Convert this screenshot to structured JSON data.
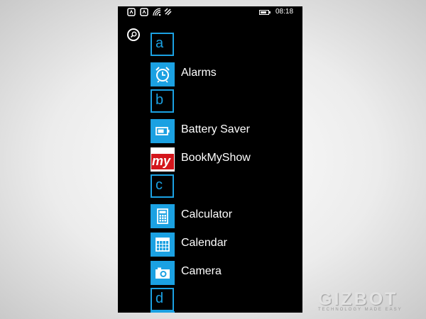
{
  "status_bar": {
    "time": "08:18",
    "icons": [
      "signal-icon",
      "signal-icon",
      "wifi-icon",
      "data-icon",
      "battery-icon"
    ]
  },
  "search": {
    "icon": "search-icon"
  },
  "sections": [
    {
      "letter": "a",
      "apps": [
        {
          "name": "Alarms",
          "icon": "alarm-clock-icon"
        }
      ]
    },
    {
      "letter": "b",
      "apps": [
        {
          "name": "Battery Saver",
          "icon": "battery-saver-icon"
        },
        {
          "name": "BookMyShow",
          "icon": "bookmyshow-logo"
        }
      ]
    },
    {
      "letter": "c",
      "apps": [
        {
          "name": "Calculator",
          "icon": "calculator-icon"
        },
        {
          "name": "Calendar",
          "icon": "calendar-icon"
        },
        {
          "name": "Camera",
          "icon": "camera-icon"
        }
      ]
    },
    {
      "letter": "d",
      "apps": []
    }
  ],
  "bookmyshow_logo_text": "my",
  "watermark": {
    "name": "GIZBOT",
    "tagline": "TECHNOLOGY MADE EASY"
  },
  "colors": {
    "accent": "#1ba1e2",
    "background": "#000000",
    "text": "#ffffff",
    "bookmyshow_red": "#d4161c"
  }
}
